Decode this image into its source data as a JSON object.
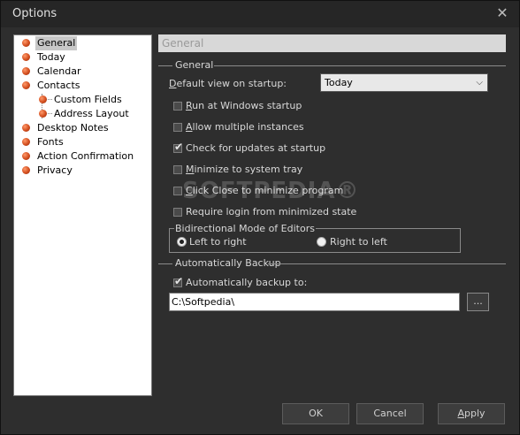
{
  "window": {
    "title": "Options",
    "close_glyph": "✕"
  },
  "tree": {
    "items": [
      {
        "label": "General",
        "selected": true
      },
      {
        "label": "Today"
      },
      {
        "label": "Calendar"
      },
      {
        "label": "Contacts"
      },
      {
        "label": "Custom Fields",
        "child": true
      },
      {
        "label": "Address Layout",
        "child": true
      },
      {
        "label": "Desktop Notes"
      },
      {
        "label": "Fonts"
      },
      {
        "label": "Action Confirmation"
      },
      {
        "label": "Privacy"
      }
    ]
  },
  "page": {
    "section_title": "General"
  },
  "general": {
    "group_label": "General",
    "default_view_label_pre": "",
    "default_view_label_u": "D",
    "default_view_label_post": "efault view on startup:",
    "default_view_value": "Today",
    "options": [
      {
        "u": "R",
        "rest": "un at Windows startup",
        "checked": false
      },
      {
        "u": "A",
        "rest": "llow multiple instances",
        "checked": false
      },
      {
        "u": "",
        "rest": "Check for updates at startup",
        "checked": true
      },
      {
        "u": "M",
        "rest": "inimize to system tray",
        "checked": false
      },
      {
        "u": "C",
        "rest": "lick Close to minimize program",
        "checked": false
      },
      {
        "u": "",
        "rest": "Require login from minimized state",
        "checked": false
      }
    ],
    "bidi": {
      "legend": "Bidirectional Mode of Editors",
      "left_to_right": "Left to right",
      "right_to_left": "Right to left",
      "selected": "left_to_right"
    }
  },
  "backup": {
    "group_label": "Automatically Backup",
    "checkbox_label": "Automatically backup to:",
    "checked": true,
    "path": "C:\\Softpedia\\",
    "browse_label": "..."
  },
  "buttons": {
    "ok": "OK",
    "cancel": "Cancel",
    "apply_u": "A",
    "apply_rest": "pply"
  },
  "watermark": "SOFTPEDIA®",
  "icons": {
    "tree_bullet": "orange-sphere-icon",
    "dropdown": "chevron-down-icon",
    "checkmark": "checkmark-icon"
  }
}
